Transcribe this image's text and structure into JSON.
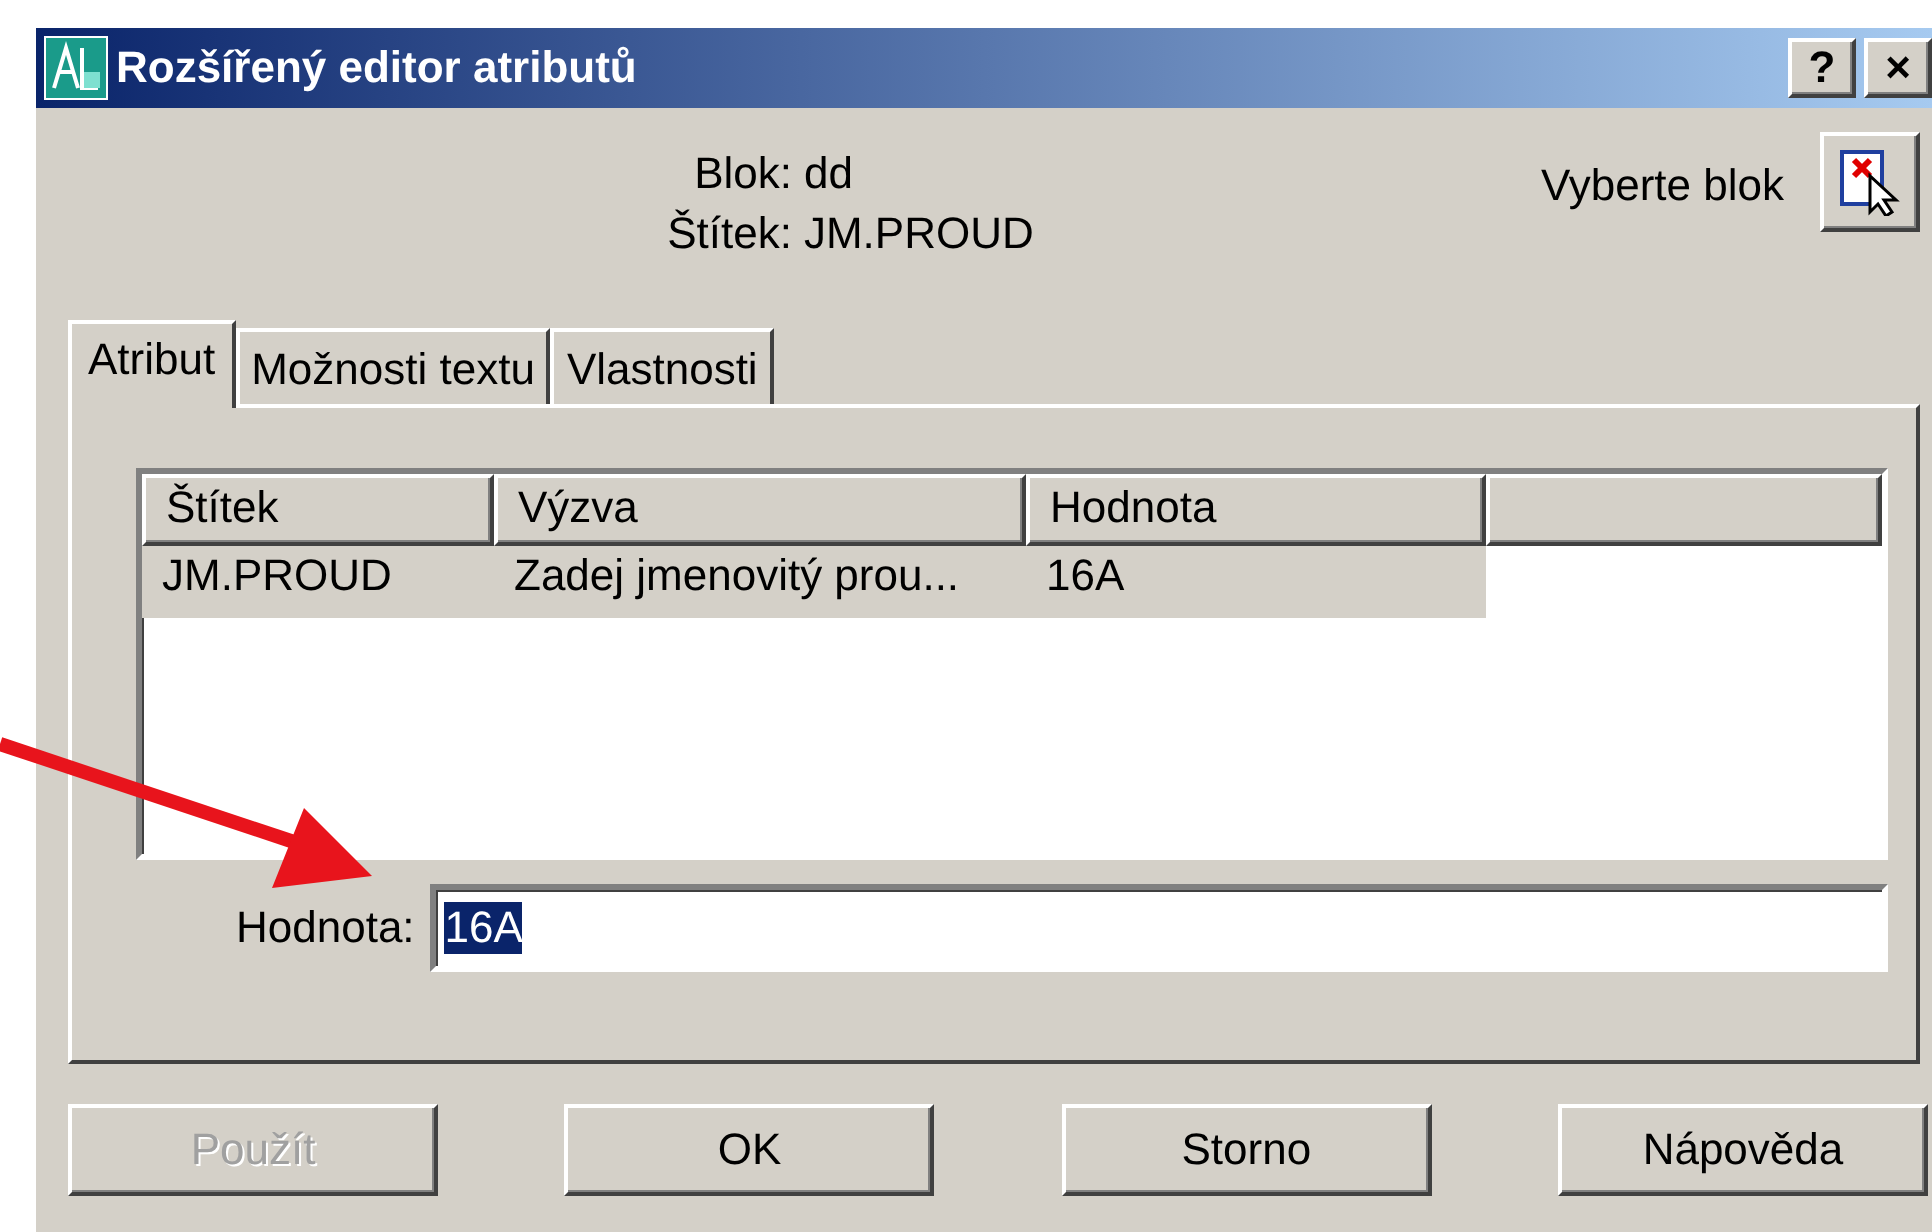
{
  "window": {
    "title": "Rozšířený editor atributů",
    "buttons": [
      "?",
      "×"
    ]
  },
  "block_info": [
    {
      "label": "Blok:",
      "value": "dd"
    },
    {
      "label": "Štítek:",
      "value": "JM.PROUD"
    }
  ],
  "select_block": {
    "label": "Vyberte blok"
  },
  "tabs": [
    {
      "label": "Atribut",
      "selected": true
    },
    {
      "label": "Možnosti textu",
      "selected": false
    },
    {
      "label": "Vlastnosti",
      "selected": false
    }
  ],
  "table": {
    "columns": [
      "Štítek",
      "Výzva",
      "Hodnota"
    ],
    "rows": [
      {
        "cells": [
          "JM.PROUD",
          "Zadej jmenovitý prou...",
          "16A"
        ],
        "selected": true
      }
    ]
  },
  "value_field": {
    "label": "Hodnota:",
    "value": "16A",
    "selected": true
  },
  "buttons": [
    {
      "label": "Použít",
      "disabled": true
    },
    {
      "label": "OK",
      "disabled": false
    },
    {
      "label": "Storno",
      "disabled": false
    },
    {
      "label": "Nápověda",
      "disabled": false
    }
  ]
}
